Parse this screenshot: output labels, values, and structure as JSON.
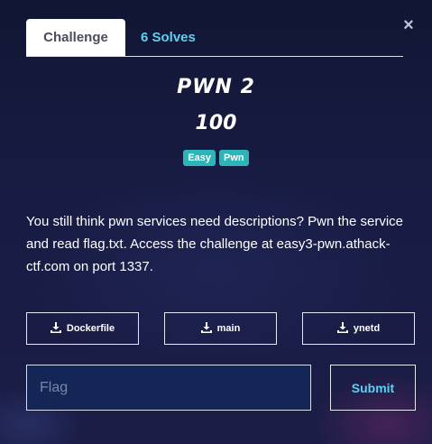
{
  "modal": {
    "close_glyph": "×"
  },
  "tabs": {
    "active_label": "Challenge",
    "solves_label": "6 Solves"
  },
  "challenge": {
    "name": "PWN 2",
    "points": "100",
    "tags": [
      "Easy",
      "Pwn"
    ],
    "tag_color": "#2bb5b8",
    "description": "You still think pwn services need descriptions? Pwn the service and read flag.txt. Access the challenge at easy3-pwn.athack-ctf.com on port 1337."
  },
  "files": [
    {
      "label": "Dockerfile",
      "icon": "download-icon"
    },
    {
      "label": "main",
      "icon": "download-icon"
    },
    {
      "label": "ynetd",
      "icon": "download-icon"
    }
  ],
  "submission": {
    "flag_placeholder": "Flag",
    "flag_value": "",
    "submit_label": "Submit"
  },
  "colors": {
    "accent": "#5fd0f0",
    "background": "#161a3d",
    "input_background": "#142655"
  }
}
